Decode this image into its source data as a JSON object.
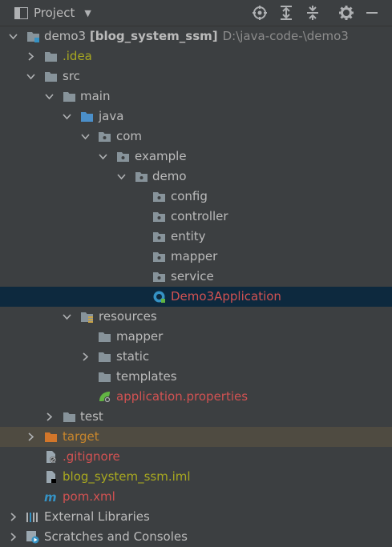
{
  "header": {
    "title": "Project",
    "buttons": [
      "locate-icon",
      "expand-all-icon",
      "collapse-all-icon",
      "settings-icon",
      "minimize-icon"
    ]
  },
  "tree": {
    "root": {
      "name": "demo3",
      "module": "[blog_system_ssm]",
      "path": "D:\\java-code-\\demo3"
    },
    "idea": ".idea",
    "src": "src",
    "main": "main",
    "java": "java",
    "com": "com",
    "example": "example",
    "demo": "demo",
    "packages": [
      "config",
      "controller",
      "entity",
      "mapper",
      "service"
    ],
    "app_class": "Demo3Application",
    "resources": "resources",
    "res_mapper": "mapper",
    "res_static": "static",
    "res_templates": "templates",
    "app_props": "application.properties",
    "test": "test",
    "target": "target",
    "gitignore": ".gitignore",
    "iml": "blog_system_ssm.iml",
    "pom": "pom.xml",
    "ext_libs": "External Libraries",
    "scratches": "Scratches and Consoles"
  },
  "colors": {
    "background": "#3c3f41",
    "selected_row": "#0d293e",
    "excluded_row": "#4f4b41",
    "text": "#bbbbbb",
    "modified_red": "#d25252",
    "ignored_olive": "#a8a820",
    "excluded_orange": "#c8862c",
    "path_grey": "#8c8c8c"
  }
}
